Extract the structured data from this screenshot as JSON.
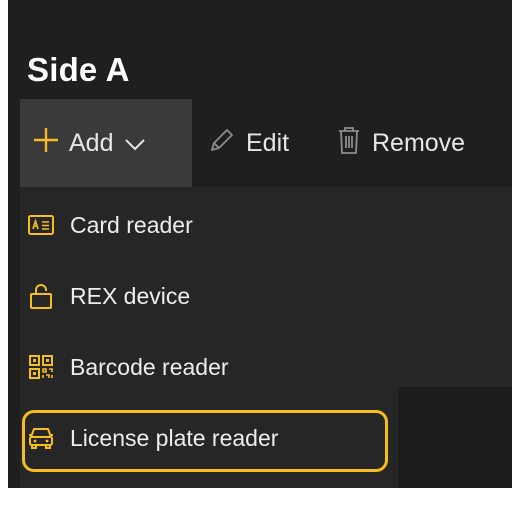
{
  "header": {
    "title": "Side A"
  },
  "toolbar": {
    "add_label": "Add",
    "edit_label": "Edit",
    "remove_label": "Remove"
  },
  "menu": {
    "items": [
      {
        "label": "Card reader",
        "icon": "card-reader-icon"
      },
      {
        "label": "REX device",
        "icon": "unlock-icon"
      },
      {
        "label": "Barcode reader",
        "icon": "qr-code-icon"
      },
      {
        "label": "License plate reader",
        "icon": "car-icon"
      }
    ]
  },
  "colors": {
    "accent": "#f5bd20",
    "background": "#1f1f1f",
    "menu_background": "#262626",
    "add_button_background": "#3a3a3a"
  }
}
